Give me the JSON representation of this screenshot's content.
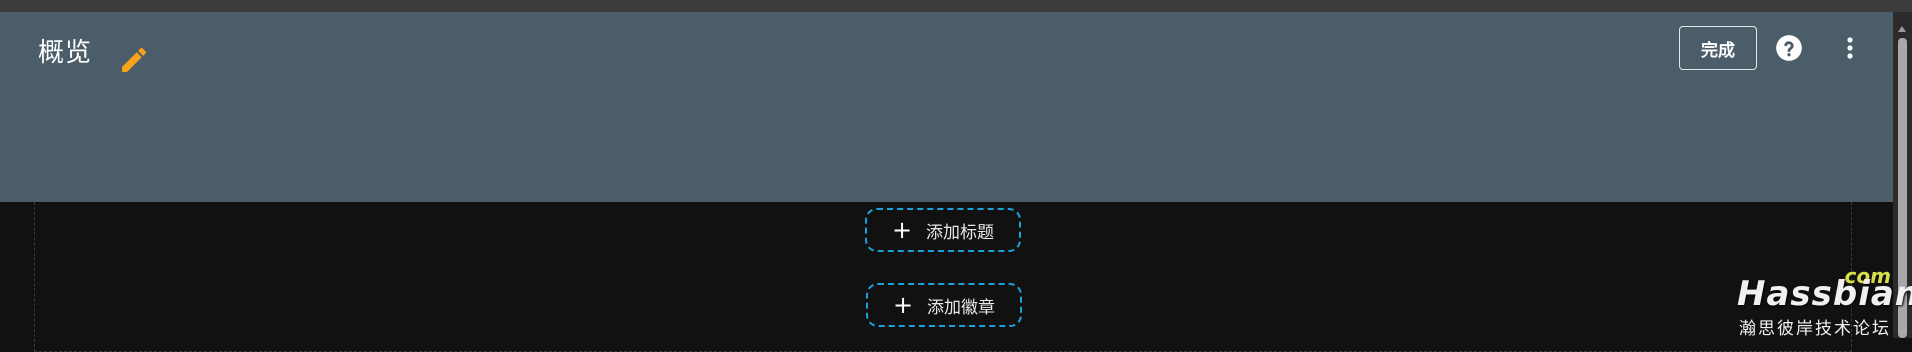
{
  "header": {
    "title": "概览",
    "edit_icon": "pencil-icon",
    "done_label": "完成",
    "help_icon": "help-circle-icon",
    "more_icon": "more-vert-icon"
  },
  "section": {
    "add_title_label": "添加标题",
    "add_badge_label": "添加徽章",
    "plus_glyph": "+"
  },
  "watermark": {
    "brand": "Hassbian",
    "tld": ".com",
    "subtitle": "瀚思彼岸技术论坛"
  },
  "colors": {
    "toolbar_bg": "#4a5d69",
    "page_bg": "#111111",
    "accent_pencil": "#f7a21b",
    "pill_border": "#1aa3d9"
  }
}
